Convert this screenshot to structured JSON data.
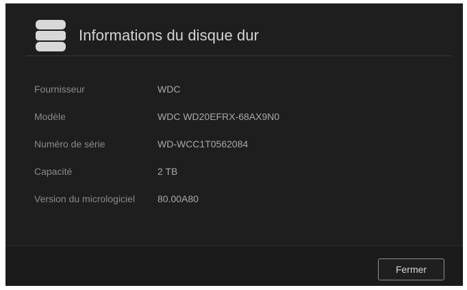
{
  "dialog": {
    "title": "Informations du disque dur",
    "icon": "disk-stack-icon",
    "fields": [
      {
        "label": "Fournisseur",
        "value": "WDC"
      },
      {
        "label": "Modèle",
        "value": "WDC WD20EFRX-68AX9N0"
      },
      {
        "label": "Numéro de série",
        "value": "WD-WCC1T0562084"
      },
      {
        "label": "Capacité",
        "value": "2 TB"
      },
      {
        "label": "Version du micrologiciel",
        "value": "80.00A80"
      }
    ],
    "close_label": "Fermer"
  },
  "colors": {
    "background": "#1e1e1f",
    "label": "#8a8a8c",
    "value": "#a9a9ab",
    "icon": "#d8d8d8"
  }
}
